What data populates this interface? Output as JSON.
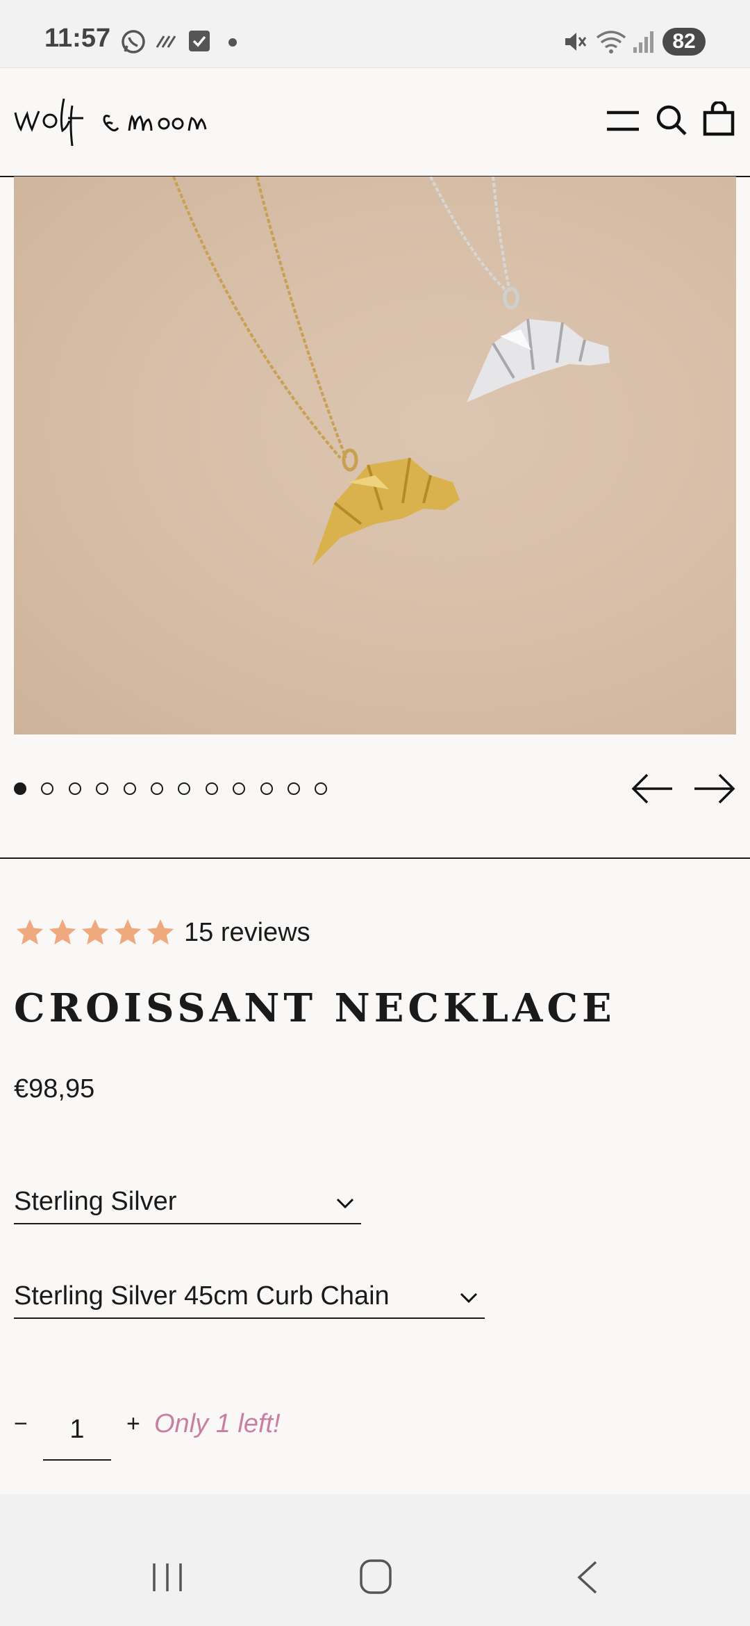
{
  "status_bar": {
    "time": "11:57",
    "battery": "82",
    "icons": [
      "whatsapp-icon",
      "signal-lines-icon",
      "checkbox-icon",
      "dot-icon",
      "mute-icon",
      "wifi-icon",
      "cell-signal-icon"
    ]
  },
  "header": {
    "logo_text": "wolf & moon",
    "icons": [
      "menu-icon",
      "search-icon",
      "bag-icon"
    ]
  },
  "gallery": {
    "image_description_icon": "product-photo",
    "total_slides": 12,
    "active_slide": 1,
    "prev_icon": "arrow-left-icon",
    "next_icon": "arrow-right-icon"
  },
  "product": {
    "rating": 5,
    "reviews_label": "15 reviews",
    "title": "CROISSANT NECKLACE",
    "price": "€98,95",
    "material_select": {
      "value": "Sterling Silver"
    },
    "chain_select": {
      "value": "Sterling Silver 45cm Curb Chain"
    },
    "quantity": {
      "minus": "−",
      "value": "1",
      "plus": "+"
    },
    "stock_note": "Only 1 left!"
  },
  "colors": {
    "star": "#f0a97e",
    "stock_note": "#c97fa2",
    "background": "#f9f8f6"
  },
  "nav_bar": {
    "icons": [
      "recent-apps-icon",
      "home-icon",
      "back-icon"
    ]
  }
}
